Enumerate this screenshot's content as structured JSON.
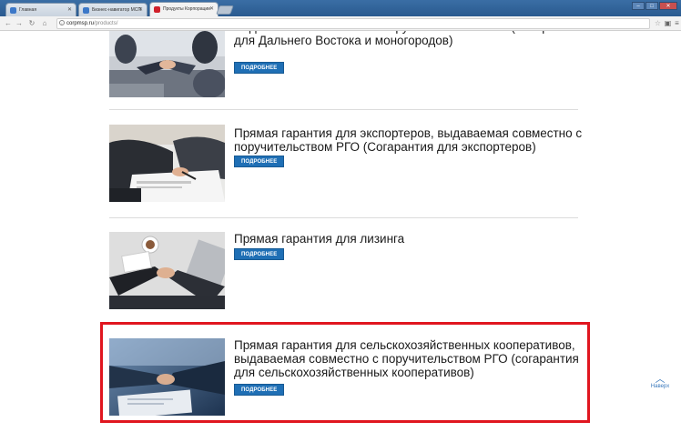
{
  "browser": {
    "tabs": [
      {
        "title": "Главная",
        "favicon_color": "#3c78c8"
      },
      {
        "title": "Бизнес-навигатор МСП",
        "favicon_color": "#3c78c8"
      },
      {
        "title": "Продукты Корпорации",
        "favicon_color": "#d0202a"
      }
    ],
    "url_host": "corpmsp.ru",
    "url_path": "/products/"
  },
  "products": [
    {
      "title": "выдаваемая совместно с поручительством РГО (Согарантия для Дальнего Востока и моногородов)",
      "button": "ПОДРОБНЕЕ",
      "image": "handshake-meeting-photo"
    },
    {
      "title": "Прямая гарантия для экспортеров, выдаваемая совместно с поручительством РГО (Согарантия для экспортеров)",
      "button": "ПОДРОБНЕЕ",
      "image": "signing-documents-photo"
    },
    {
      "title": "Прямая гарантия для лизинга",
      "button": "ПОДРОБНЕЕ",
      "image": "handshake-over-desk-photo"
    },
    {
      "title": "Прямая гарантия для сельскохозяйственных кооперативов, выдаваемая совместно с поручительством РГО (согарантия для сельскохозяйственных кооперативов)",
      "button": "ПОДРОБНЕЕ",
      "image": "business-handshake-photo"
    }
  ],
  "to_top": {
    "label": "Наверх",
    "icon": "chevron-up-icon"
  },
  "colors": {
    "button": "#1f6fb5",
    "highlight": "#e0161f",
    "link": "#3a79bd"
  }
}
